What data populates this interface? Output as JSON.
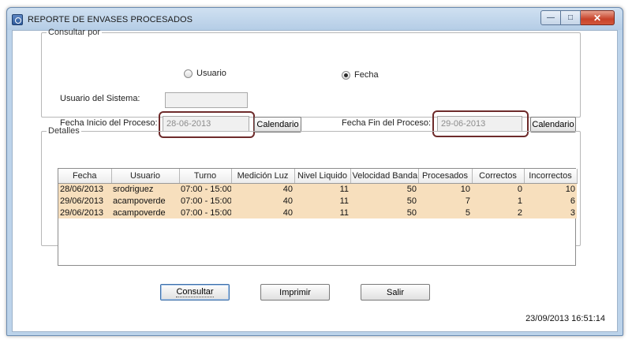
{
  "window": {
    "title": "REPORTE DE ENVASES PROCESADOS",
    "min_glyph": "—",
    "max_glyph": "□",
    "close_glyph": "✕"
  },
  "consultar": {
    "legend": "Consultar por",
    "radio_usuario": "Usuario",
    "radio_fecha": "Fecha",
    "selected": "Fecha",
    "usuario_label": "Usuario del Sistema:",
    "usuario_value": "",
    "inicio_label": "Fecha Inicio del Proceso:",
    "inicio_value": "28-06-2013",
    "fin_label": "Fecha Fin del Proceso:",
    "fin_value": "29-06-2013",
    "calendario_label": "Calendario"
  },
  "detalles": {
    "legend": "Detalles",
    "columns": [
      "Fecha",
      "Usuario",
      "Turno",
      "Medición Luz",
      "Nivel Liquido",
      "Velocidad Banda",
      "Procesados",
      "Correctos",
      "Incorrectos"
    ],
    "rows": [
      [
        "28/06/2013",
        "srodriguez",
        "07:00 - 15:00",
        "40",
        "11",
        "50",
        "10",
        "0",
        "10"
      ],
      [
        "29/06/2013",
        "acampoverde",
        "07:00 - 15:00",
        "40",
        "11",
        "50",
        "7",
        "1",
        "6"
      ],
      [
        "29/06/2013",
        "acampoverde",
        "07:00 - 15:00",
        "40",
        "11",
        "50",
        "5",
        "2",
        "3"
      ]
    ]
  },
  "actions": {
    "consultar": "Consultar",
    "imprimir": "Imprimir",
    "salir": "Salir"
  },
  "status": {
    "timestamp": "23/09/2013 16:51:14"
  },
  "colors": {
    "row_highlight": "#f7dfbd",
    "annotation_box": "#6e2b2b",
    "window_frame": "#bcd3ea"
  }
}
